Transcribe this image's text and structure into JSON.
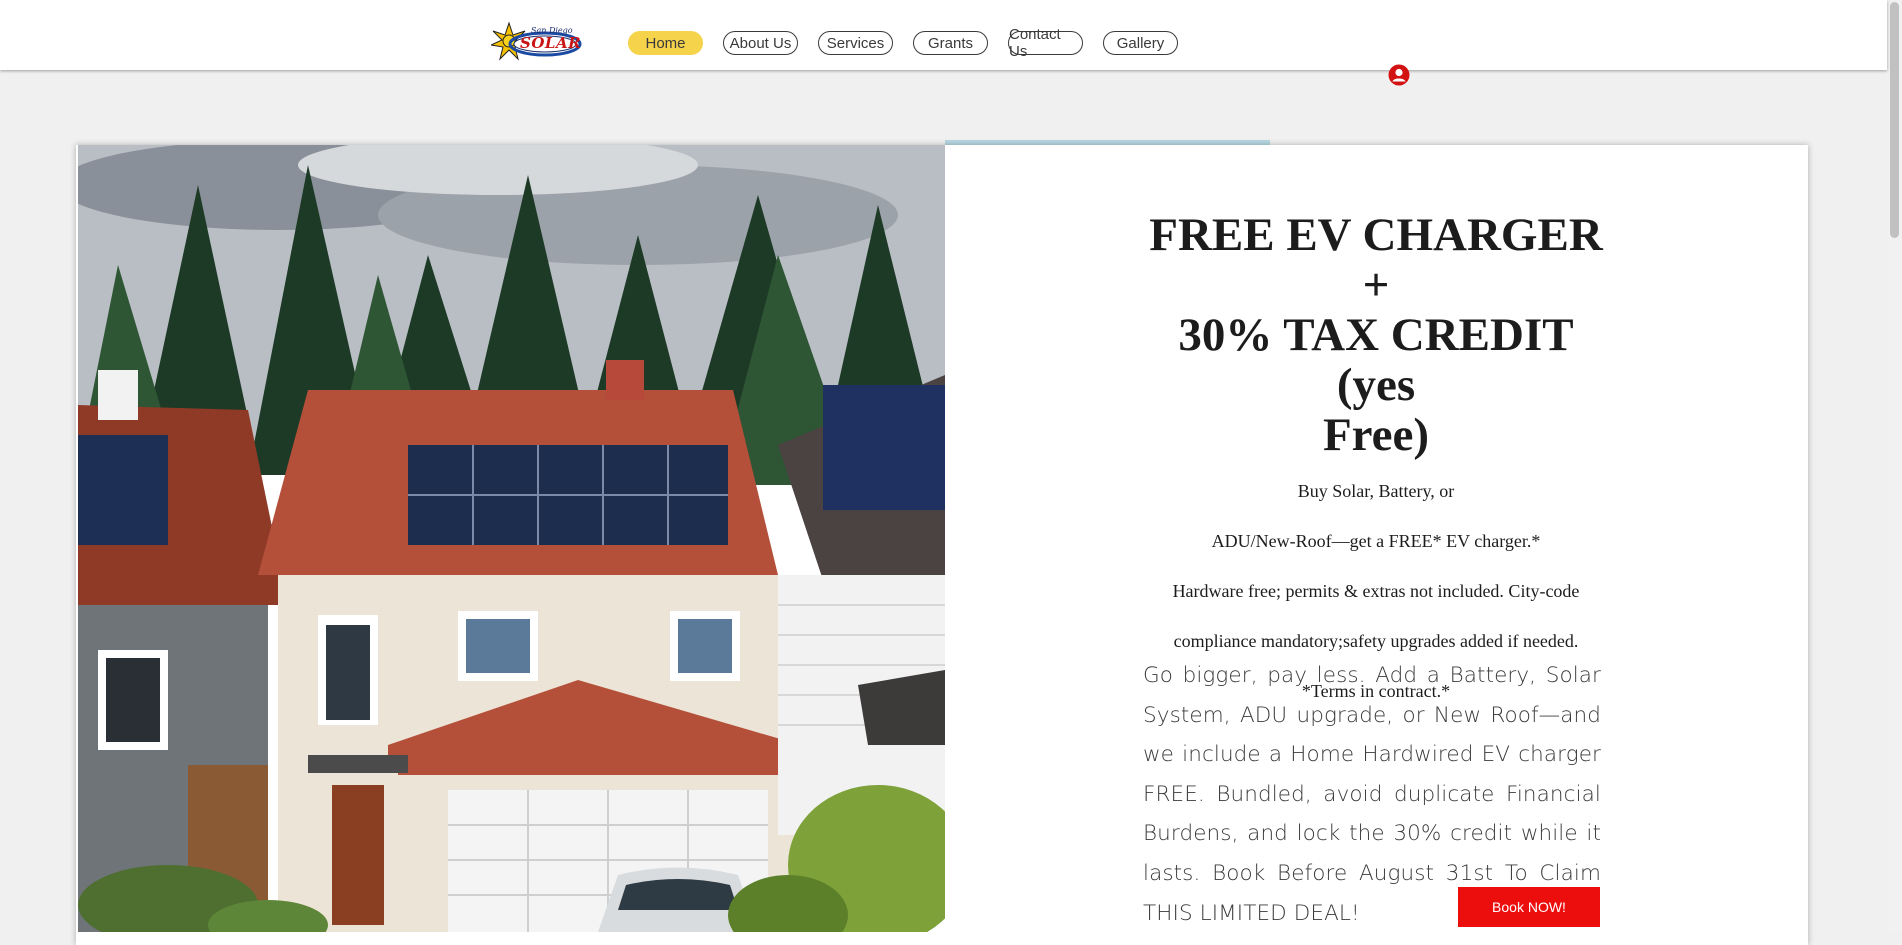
{
  "brand": {
    "logo_top": "San Diego",
    "logo_text": "SOLAR"
  },
  "nav": {
    "items": [
      {
        "label": "Home",
        "active": true
      },
      {
        "label": "About Us"
      },
      {
        "label": "Services"
      },
      {
        "label": "Grants"
      },
      {
        "label": "Contact Us"
      },
      {
        "label": "Gallery"
      }
    ]
  },
  "hero": {
    "headline_lines": [
      "FREE EV CHARGER +",
      "30% TAX CREDIT (yes",
      "Free)"
    ],
    "notes": [
      "Buy Solar, Battery, or",
      "ADU/New-Roof—get a FREE* EV charger.*",
      "Hardware free; permits & extras not included. City-code",
      "compliance mandatory;safety upgrades added if needed.",
      "*Terms in contract.*"
    ],
    "body": "Go bigger, pay less. Add a Battery, Solar System, ADU upgrade, or New Roof—and we include a Home Hardwired EV charger FREE. Bundled, avoid duplicate Financial Burdens, and lock the 30% credit while it lasts. Book Before August 31st To Claim THIS LIMITED DEAL!",
    "cta": "Book NOW!"
  },
  "icons": {
    "logo": "sun-logo-icon",
    "user": "user-account-icon"
  },
  "colors": {
    "accent": "#f5d34b",
    "cta": "#ec0d0d",
    "stripe": "#b7d8e3"
  }
}
